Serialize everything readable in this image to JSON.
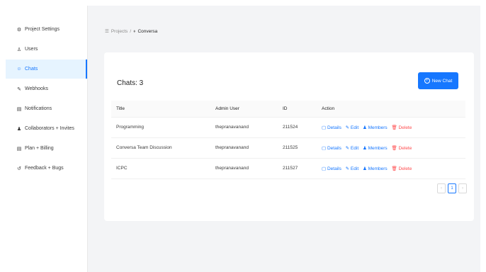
{
  "sidebar": {
    "items": [
      {
        "icon": "⚙",
        "label": "Project Settings",
        "active": false
      },
      {
        "icon": "♙",
        "label": "Users",
        "active": false
      },
      {
        "icon": "☺",
        "label": "Chats",
        "active": true
      },
      {
        "icon": "✎",
        "label": "Webhooks",
        "active": false
      },
      {
        "icon": "▤",
        "label": "Notifications",
        "active": false
      },
      {
        "icon": "♟",
        "label": "Collaborators + Invites",
        "active": false
      },
      {
        "icon": "▤",
        "label": "Plan + Billing",
        "active": false
      },
      {
        "icon": "↺",
        "label": "Feedback + Bugs",
        "active": false
      }
    ]
  },
  "breadcrumb": {
    "root": "Projects",
    "separator": "/",
    "current": "Conversa"
  },
  "card": {
    "title": "Chats: 3",
    "new_chat_label": "New Chat"
  },
  "table": {
    "headers": [
      "Title",
      "Admin User",
      "ID",
      "Action"
    ],
    "rows": [
      {
        "title": "Programming",
        "admin": "thepranavanand",
        "id": "211524"
      },
      {
        "title": "Conversa Team Discussion",
        "admin": "thepranavanand",
        "id": "211525"
      },
      {
        "title": "ICPC",
        "admin": "thepranavanand",
        "id": "211527"
      }
    ],
    "actions": {
      "details": "Details",
      "edit": "Edit",
      "members": "Members",
      "delete": "Delete"
    }
  },
  "pagination": {
    "prev": "‹",
    "current": "1",
    "next": "›"
  },
  "colors": {
    "primary": "#1677ff",
    "danger": "#ff4d4f",
    "bg": "#f3f4f6"
  }
}
